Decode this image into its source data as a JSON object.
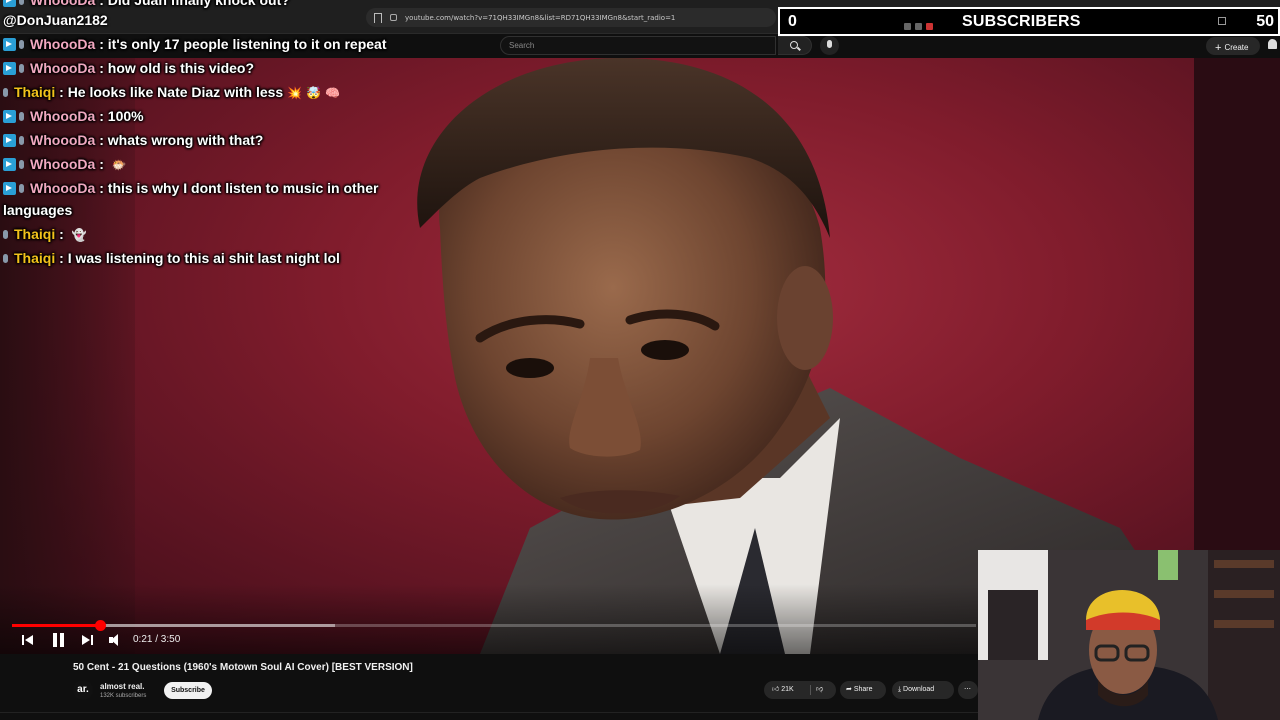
{
  "browser": {
    "url": "youtube.com/watch?v=71QH33IMGn8&list=RD71QH33IMGn8&start_radio=1"
  },
  "youtube": {
    "search_placeholder": "Search",
    "create_label": "Create"
  },
  "player": {
    "time_display": "0:21 / 3:50",
    "progress_fraction": 0.0913,
    "buffered_fraction": 0.335
  },
  "video": {
    "title": "50 Cent - 21 Questions (1960's Motown Soul AI Cover) [BEST VERSION]",
    "channel_avatar_text": "ar.",
    "channel_name": "almost real.",
    "channel_subscribers": "132K subscribers",
    "subscribe_label": "Subscribe",
    "like_count": "21K",
    "share_label": "Share",
    "download_label": "Download"
  },
  "overlay": {
    "streamer_handle": "@DonJuan2182",
    "subscriber_count": "0",
    "subscriber_label": "SUBSCRIBERS",
    "subscriber_goal": "50",
    "chat": [
      {
        "user": "WhoooDa",
        "message": "Did Juan finally knock out?"
      },
      {
        "user": "WhoooDa",
        "message": "it's only 17 people listening to it on repeat"
      },
      {
        "user": "WhoooDa",
        "message": "how old is this video?"
      },
      {
        "user": "Thaiqi",
        "message": "He looks like Nate Diaz with less"
      },
      {
        "user": "WhoooDa",
        "message": "100%"
      },
      {
        "user": "WhoooDa",
        "message": "whats wrong with that?"
      },
      {
        "user": "WhoooDa",
        "message": ""
      },
      {
        "user": "WhoooDa",
        "message": "this is why I dont listen to music in other"
      },
      {
        "user": "",
        "message": "languages"
      },
      {
        "user": "Thaiqi",
        "message": ""
      },
      {
        "user": "Thaiqi",
        "message": "I was listening to this ai shit last night lol"
      }
    ],
    "separator": " : "
  },
  "colors": {
    "accent_red": "#ff0000",
    "chat_user_whoooda": "#f0a8c0",
    "chat_user_thaiqi": "#f2c21b",
    "video_bg": "#801c2c"
  }
}
